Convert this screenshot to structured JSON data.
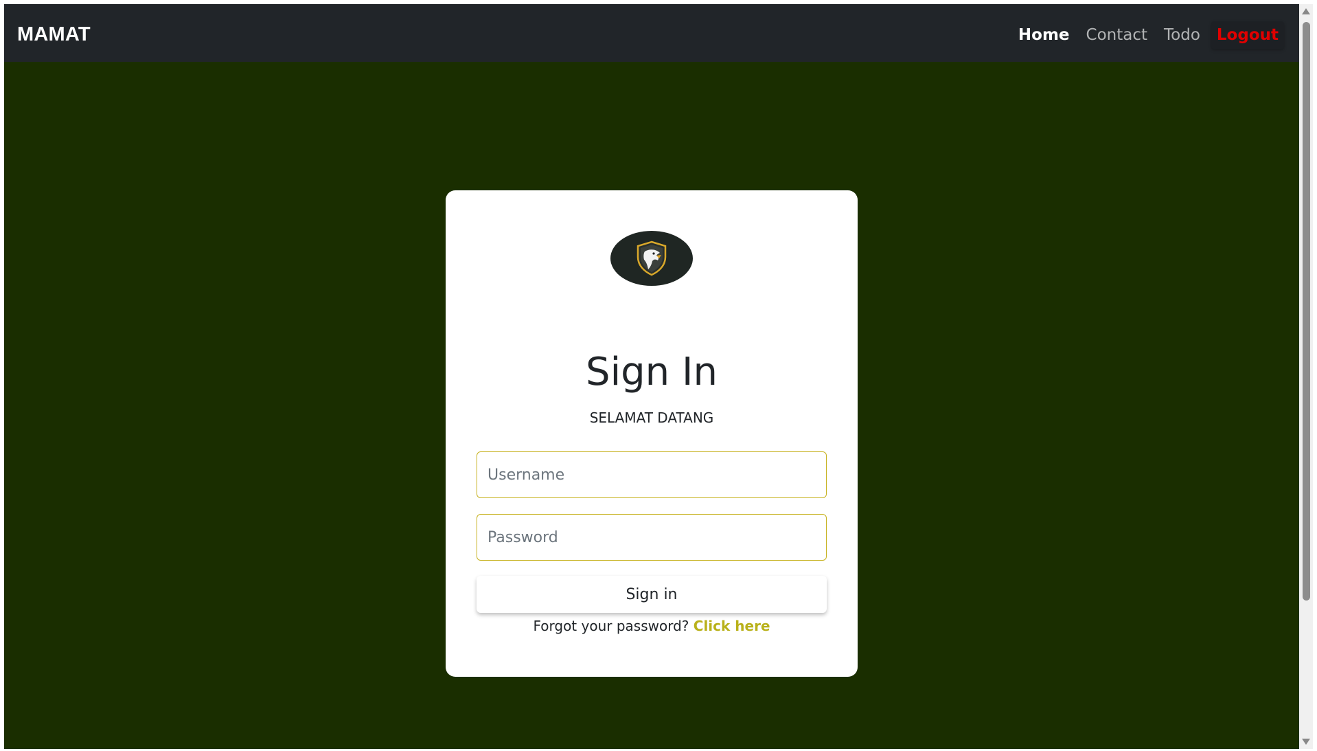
{
  "navbar": {
    "brand": "MAMAT",
    "items": [
      {
        "label": "Home"
      },
      {
        "label": "Contact"
      },
      {
        "label": "Todo"
      },
      {
        "label": "Logout"
      }
    ]
  },
  "login": {
    "logo_icon": "eagle-shield-icon",
    "title": "Sign In",
    "subtitle": "SELAMAT DATANG",
    "username_placeholder": "Username",
    "username_value": "",
    "password_placeholder": "Password",
    "password_value": "",
    "signin_label": "Sign in",
    "forgot_text": "Forgot your password?",
    "forgot_link": "Click here"
  },
  "colors": {
    "background": "#1a2e00",
    "navbar": "#212529",
    "logout": "#e00000",
    "accent": "#b9b11a",
    "input_border": "#c7b21f"
  }
}
